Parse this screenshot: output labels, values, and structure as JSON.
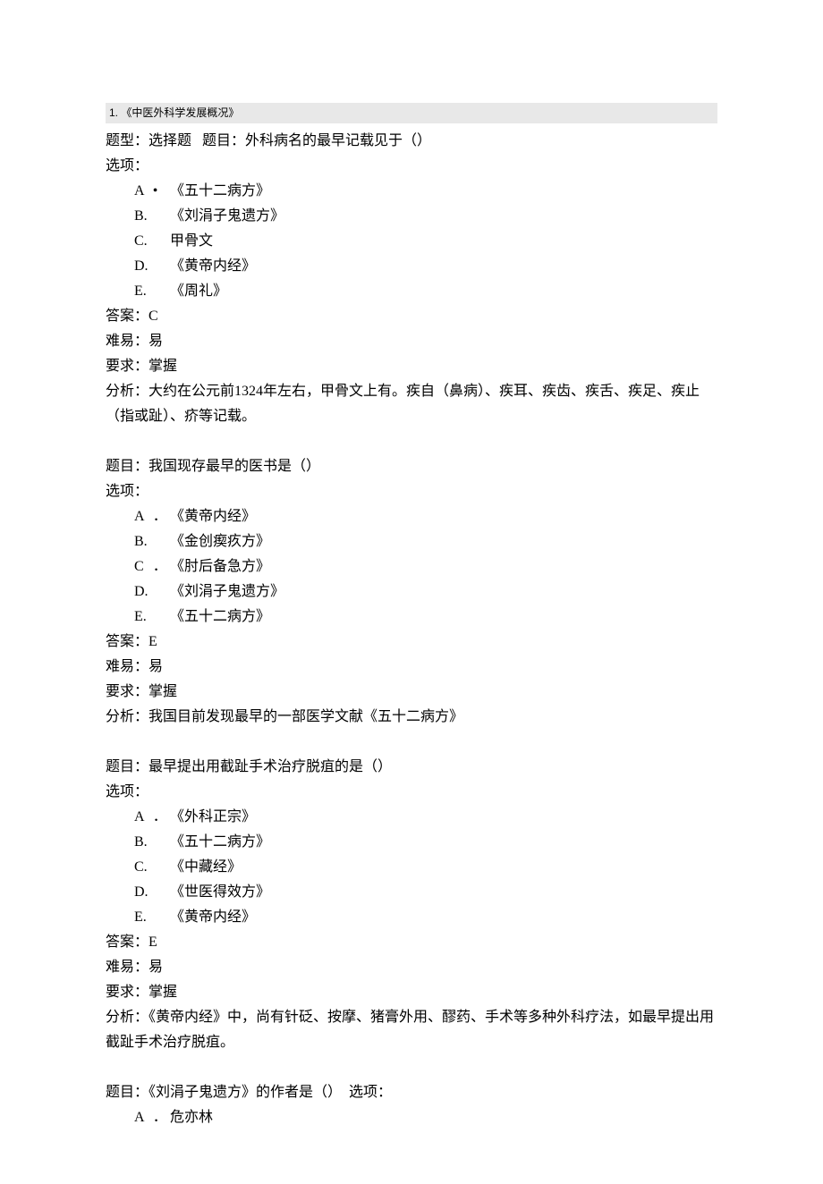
{
  "section": {
    "number": "1.",
    "title": "《中医外科学发展概况》"
  },
  "questions": [
    {
      "type_label": "题型：选择题",
      "stem_label": "题目：",
      "stem": "外科病名的最早记载见于（）",
      "options_label": "选项：",
      "options": [
        {
          "letter": "A",
          "sep": "•",
          "text": "《五十二病方》"
        },
        {
          "letter": "B.",
          "sep": "",
          "text": "《刘涓子鬼遗方》"
        },
        {
          "letter": "C.",
          "sep": "",
          "text": "甲骨文"
        },
        {
          "letter": "D.",
          "sep": "",
          "text": "《黄帝内经》"
        },
        {
          "letter": "E.",
          "sep": "",
          "text": "《周礼》"
        }
      ],
      "answer_label": "答案：",
      "answer": "C",
      "difficulty_label": "难易：",
      "difficulty": "易",
      "requirement_label": "要求：",
      "requirement": "掌握",
      "analysis_label": "分析：",
      "analysis": "大约在公元前1324年左右，甲骨文上有。疾自（鼻病）、疾耳、疾齿、疾舌、疾足、疾止（指或趾）、疥等记载。"
    },
    {
      "stem_label": "题目：",
      "stem": "我国现存最早的医书是（）",
      "options_label": "选项：",
      "options": [
        {
          "letter": "A",
          "sep": "．",
          "text": "《黄帝内经》"
        },
        {
          "letter": "B.",
          "sep": "",
          "text": "《金创瘈疚方》"
        },
        {
          "letter": "C",
          "sep": "．",
          "text": "《肘后备急方》"
        },
        {
          "letter": "D.",
          "sep": "",
          "text": "《刘涓子鬼遗方》"
        },
        {
          "letter": "E.",
          "sep": "",
          "text": "《五十二病方》"
        }
      ],
      "answer_label": "答案：",
      "answer": "E",
      "difficulty_label": "难易：",
      "difficulty": "易",
      "requirement_label": "要求：",
      "requirement": "掌握",
      "analysis_label": "分析：",
      "analysis": "我国目前发现最早的一部医学文献《五十二病方》"
    },
    {
      "stem_label": "题目：",
      "stem": "最早提出用截趾手术治疗脱疽的是（）",
      "options_label": "选项：",
      "options": [
        {
          "letter": "A",
          "sep": "．",
          "text": "《外科正宗》"
        },
        {
          "letter": "B.",
          "sep": "",
          "text": "《五十二病方》"
        },
        {
          "letter": "C.",
          "sep": "",
          "text": "《中藏经》"
        },
        {
          "letter": "D.",
          "sep": "",
          "text": "《世医得效方》"
        },
        {
          "letter": "E.",
          "sep": "",
          "text": "《黄帝内经》"
        }
      ],
      "answer_label": "答案：",
      "answer": "E",
      "difficulty_label": "难易：",
      "difficulty": "易",
      "requirement_label": "要求：",
      "requirement": "掌握",
      "analysis_label": "分析：",
      "analysis": "《黄帝内经》中，尚有针砭、按摩、猪膏外用、醪药、手术等多种外科疗法，如最早提出用截趾手术治疗脱疽。"
    },
    {
      "stem_label": "题目：",
      "stem": "《刘涓子鬼遗方》的作者是（）",
      "options_label_inline": "选项：",
      "options": [
        {
          "letter": "A",
          "sep": "．",
          "text": "危亦林"
        }
      ]
    }
  ]
}
